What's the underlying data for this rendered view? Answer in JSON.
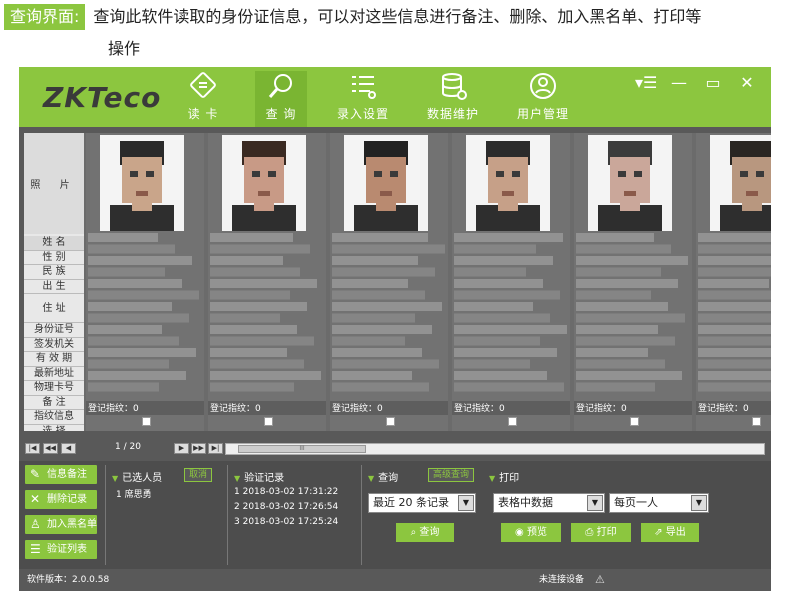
{
  "caption": {
    "tag": "查询界面:",
    "line1": "查询此软件读取的身份证信息，可以对这些信息进行备注、删除、加入黑名单、打印等",
    "line2": "操作"
  },
  "app": {
    "logo": "ZKTeco",
    "nav": [
      {
        "label": "读 卡",
        "icon": "card-reader-icon"
      },
      {
        "label": "查 询",
        "icon": "search-icon",
        "active": true
      },
      {
        "label": "录入设置",
        "icon": "list-settings-icon"
      },
      {
        "label": "数据维护",
        "icon": "database-icon"
      },
      {
        "label": "用户管理",
        "icon": "user-icon"
      }
    ],
    "window_controls": {
      "menu": "▾☰",
      "minimize": "—",
      "maximize": "▭",
      "close": "✕"
    }
  },
  "grid": {
    "photo_label": "照 片",
    "field_labels": [
      "姓 名",
      "性 别",
      "民 族",
      "出 生",
      "住 址",
      "身份证号",
      "签发机关",
      "有 效 期",
      "最新地址",
      "物理卡号",
      "备 注",
      "指纹信息",
      "选 择"
    ],
    "cards": [
      {
        "fingerprint": "登记指纹：0"
      },
      {
        "fingerprint": "登记指纹：0"
      },
      {
        "fingerprint": "登记指纹：0"
      },
      {
        "fingerprint": "登记指纹：0"
      },
      {
        "fingerprint": "登记指纹：0"
      },
      {
        "fingerprint": "登记指纹：0"
      }
    ]
  },
  "pager": {
    "text": "1 / 20",
    "thumb": "III"
  },
  "actions": [
    {
      "label": "信息备注",
      "icon": "pencil-icon"
    },
    {
      "label": "删除记录",
      "icon": "delete-x-icon"
    },
    {
      "label": "加入黑名单",
      "icon": "user-block-icon"
    },
    {
      "label": "验证列表",
      "icon": "list-icon"
    }
  ],
  "selected_panel": {
    "title": "已选人员",
    "cancel": "取消",
    "items": [
      "1 席思勇"
    ]
  },
  "verify_panel": {
    "title": "验证记录",
    "items": [
      "1  2018-03-02 17:31:22",
      "2  2018-03-02 17:26:54",
      "3  2018-03-02 17:25:24"
    ]
  },
  "query_panel": {
    "title": "查询",
    "advanced": "高级查询",
    "select": "最近 20 条记录",
    "button": "查询"
  },
  "print_panel": {
    "title": "打印",
    "select1": "表格中数据",
    "select2": "每页一人",
    "preview": "预览",
    "print": "打印",
    "export": "导出"
  },
  "status": {
    "version": "软件版本：2.0.0.58",
    "device": "未连接设备"
  }
}
